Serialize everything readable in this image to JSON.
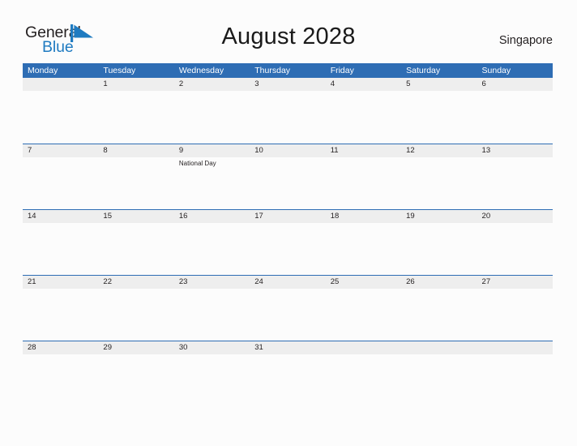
{
  "brand": {
    "name_part1": "General",
    "name_part2": "Blue",
    "flag_icon": "blue-triangle-flag",
    "accent_color": "#1f7bc1"
  },
  "header": {
    "title": "August 2028",
    "country": "Singapore"
  },
  "theme": {
    "header_blue": "#2e6db4",
    "band_gray": "#eeeeee",
    "page_background": "#fcfcfc",
    "text_dark": "#231f20"
  },
  "calendar": {
    "month": "August",
    "year": "2028",
    "weekday_headers": [
      "Monday",
      "Tuesday",
      "Wednesday",
      "Thursday",
      "Friday",
      "Saturday",
      "Sunday"
    ],
    "weeks": [
      {
        "days": [
          {
            "number": "",
            "events": []
          },
          {
            "number": "1",
            "events": []
          },
          {
            "number": "2",
            "events": []
          },
          {
            "number": "3",
            "events": []
          },
          {
            "number": "4",
            "events": []
          },
          {
            "number": "5",
            "events": []
          },
          {
            "number": "6",
            "events": []
          }
        ]
      },
      {
        "days": [
          {
            "number": "7",
            "events": []
          },
          {
            "number": "8",
            "events": []
          },
          {
            "number": "9",
            "events": [
              "National Day"
            ]
          },
          {
            "number": "10",
            "events": []
          },
          {
            "number": "11",
            "events": []
          },
          {
            "number": "12",
            "events": []
          },
          {
            "number": "13",
            "events": []
          }
        ]
      },
      {
        "days": [
          {
            "number": "14",
            "events": []
          },
          {
            "number": "15",
            "events": []
          },
          {
            "number": "16",
            "events": []
          },
          {
            "number": "17",
            "events": []
          },
          {
            "number": "18",
            "events": []
          },
          {
            "number": "19",
            "events": []
          },
          {
            "number": "20",
            "events": []
          }
        ]
      },
      {
        "days": [
          {
            "number": "21",
            "events": []
          },
          {
            "number": "22",
            "events": []
          },
          {
            "number": "23",
            "events": []
          },
          {
            "number": "24",
            "events": []
          },
          {
            "number": "25",
            "events": []
          },
          {
            "number": "26",
            "events": []
          },
          {
            "number": "27",
            "events": []
          }
        ]
      },
      {
        "days": [
          {
            "number": "28",
            "events": []
          },
          {
            "number": "29",
            "events": []
          },
          {
            "number": "30",
            "events": []
          },
          {
            "number": "31",
            "events": []
          },
          {
            "number": "",
            "events": []
          },
          {
            "number": "",
            "events": []
          },
          {
            "number": "",
            "events": []
          }
        ]
      }
    ]
  }
}
